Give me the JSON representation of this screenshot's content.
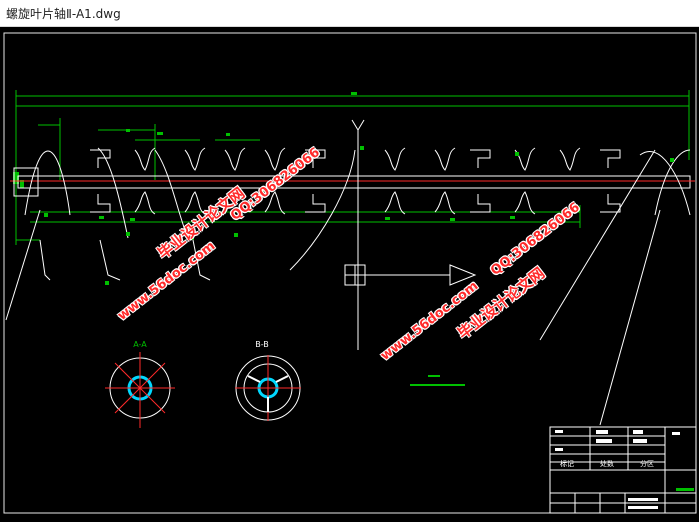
{
  "window": {
    "title": "螺旋叶片轴Ⅱ-A1.dwg"
  },
  "drawing": {
    "section_labels": {
      "a": "A-A",
      "b": "B-B"
    },
    "watermarks": {
      "site": "www.56doc.com",
      "brand": "毕业设计论文网",
      "qq": "QQ:306826066"
    },
    "title_block": {
      "sign_1": "标记",
      "sign_2": "处数",
      "sign_3": "分区"
    }
  }
}
